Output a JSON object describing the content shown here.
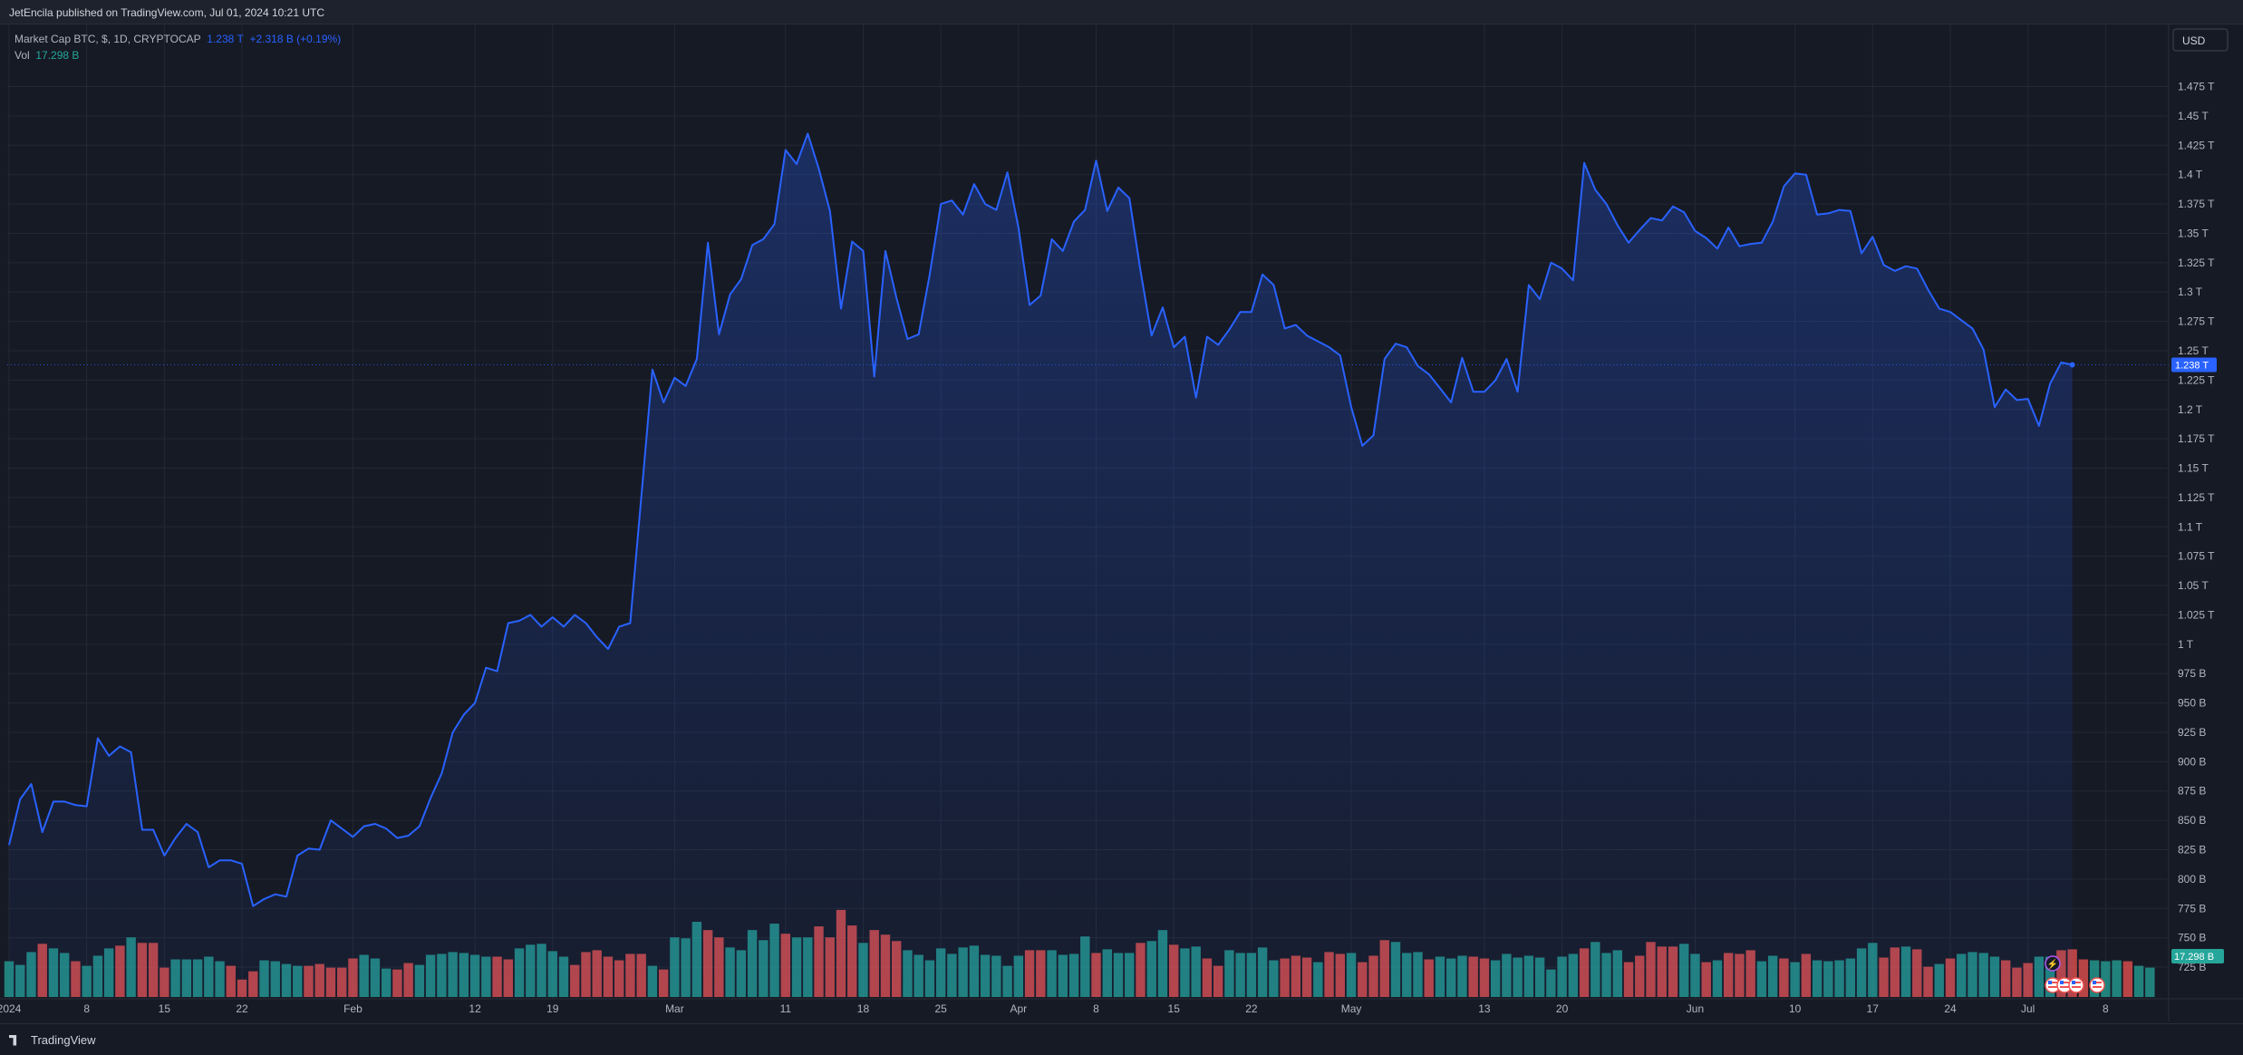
{
  "header": {
    "published_text": "JetEncila published on TradingView.com, Jul 01, 2024 10:21 UTC"
  },
  "legend": {
    "series_label": "Market Cap BTC, $, 1D, CRYPTOCAP",
    "last_value": "1.238 T",
    "change": "+2.318 B (+0.19%)",
    "volume_label": "Vol",
    "volume_value": "17.298 B"
  },
  "currency_button": "USD",
  "brand": "TradingView",
  "colors": {
    "line": "#2962ff",
    "vol_up": "#26a69a",
    "vol_down": "#ef5350",
    "background": "#161a25",
    "grid": "#232834",
    "price_label_bg": "#2962ff",
    "vol_label_bg": "#26a69a"
  },
  "icons": [
    "lightning-icon",
    "us-flag-icon",
    "us-flag-icon",
    "us-flag-icon",
    "us-flag-icon"
  ],
  "chart_data": {
    "type": "line",
    "title": "",
    "xlabel": "",
    "ylabel": "",
    "y_scale": "linear",
    "ylim": [
      715,
      1487
    ],
    "y_unit": "B",
    "y_ticks": [
      "1.475 T",
      "1.45 T",
      "1.425 T",
      "1.4 T",
      "1.375 T",
      "1.35 T",
      "1.325 T",
      "1.3 T",
      "1.275 T",
      "1.25 T",
      "1.225 T",
      "1.2 T",
      "1.175 T",
      "1.15 T",
      "1.125 T",
      "1.1 T",
      "1.075 T",
      "1.05 T",
      "1.025 T",
      "1 T",
      "975 B",
      "950 B",
      "925 B",
      "900 B",
      "875 B",
      "850 B",
      "825 B",
      "800 B",
      "775 B",
      "750 B",
      "725 B"
    ],
    "y_tick_values": [
      1475,
      1450,
      1425,
      1400,
      1375,
      1350,
      1325,
      1300,
      1275,
      1250,
      1225,
      1200,
      1175,
      1150,
      1125,
      1100,
      1075,
      1050,
      1025,
      1000,
      975,
      950,
      925,
      900,
      875,
      850,
      825,
      800,
      775,
      750,
      725
    ],
    "x_ticks": [
      {
        "label": "2024",
        "date": "2024-01-01"
      },
      {
        "label": "8",
        "date": "2024-01-08"
      },
      {
        "label": "15",
        "date": "2024-01-15"
      },
      {
        "label": "22",
        "date": "2024-01-22"
      },
      {
        "label": "Feb",
        "date": "2024-02-01"
      },
      {
        "label": "12",
        "date": "2024-02-12"
      },
      {
        "label": "19",
        "date": "2024-02-19"
      },
      {
        "label": "Mar",
        "date": "2024-03-01"
      },
      {
        "label": "11",
        "date": "2024-03-11"
      },
      {
        "label": "18",
        "date": "2024-03-18"
      },
      {
        "label": "25",
        "date": "2024-03-25"
      },
      {
        "label": "Apr",
        "date": "2024-04-01"
      },
      {
        "label": "8",
        "date": "2024-04-08"
      },
      {
        "label": "15",
        "date": "2024-04-15"
      },
      {
        "label": "22",
        "date": "2024-04-22"
      },
      {
        "label": "May",
        "date": "2024-05-01"
      },
      {
        "label": "13",
        "date": "2024-05-13"
      },
      {
        "label": "20",
        "date": "2024-05-20"
      },
      {
        "label": "Jun",
        "date": "2024-06-01"
      },
      {
        "label": "10",
        "date": "2024-06-10"
      },
      {
        "label": "17",
        "date": "2024-06-17"
      },
      {
        "label": "24",
        "date": "2024-06-24"
      },
      {
        "label": "Jul",
        "date": "2024-07-01"
      },
      {
        "label": "8",
        "date": "2024-07-08"
      }
    ],
    "x_range": [
      "2024-01-01",
      "2024-07-12"
    ],
    "start_date": "2024-01-01",
    "series": [
      {
        "name": "Market Cap BTC",
        "values": [
          829,
          868,
          881,
          840,
          866,
          866,
          863,
          862,
          920,
          905,
          913,
          908,
          842,
          842,
          820,
          835,
          847,
          840,
          810,
          816,
          816,
          813,
          777,
          783,
          787,
          785,
          820,
          826,
          825,
          850,
          843,
          836,
          845,
          847,
          843,
          835,
          837,
          845,
          869,
          890,
          925,
          940,
          950,
          980,
          977,
          1018,
          1020,
          1025,
          1015,
          1023,
          1015,
          1025,
          1018,
          1006,
          996,
          1015,
          1018,
          1126,
          1234,
          1206,
          1227,
          1220,
          1243,
          1342,
          1264,
          1298,
          1311,
          1340,
          1345,
          1358,
          1421,
          1409,
          1435,
          1405,
          1369,
          1286,
          1343,
          1335,
          1228,
          1335,
          1295,
          1260,
          1264,
          1315,
          1375,
          1378,
          1366,
          1392,
          1375,
          1370,
          1402,
          1355,
          1289,
          1297,
          1345,
          1335,
          1360,
          1370,
          1412,
          1369,
          1389,
          1380,
          1318,
          1263,
          1287,
          1253,
          1262,
          1210,
          1262,
          1255,
          1268,
          1283,
          1283,
          1315,
          1306,
          1269,
          1272,
          1263,
          1258,
          1253,
          1246,
          1202,
          1169,
          1178,
          1243,
          1256,
          1253,
          1237,
          1230,
          1218,
          1206,
          1244,
          1215,
          1215,
          1225,
          1243,
          1215,
          1306,
          1294,
          1325,
          1320,
          1310,
          1410,
          1387,
          1375,
          1357,
          1342,
          1353,
          1363,
          1361,
          1373,
          1368,
          1352,
          1346,
          1337,
          1355,
          1339,
          1341,
          1342,
          1360,
          1390,
          1401,
          1400,
          1366,
          1367,
          1370,
          1369,
          1333,
          1347,
          1323,
          1318,
          1322,
          1320,
          1302,
          1286,
          1283,
          1276,
          1269,
          1251,
          1202,
          1217,
          1208,
          1209,
          1186,
          1222,
          1240,
          1238
        ]
      },
      {
        "name": "Vol",
        "values": [
          39,
          35,
          49,
          58,
          53,
          48,
          39,
          34,
          45,
          53,
          56,
          65,
          59,
          59,
          32,
          41,
          41,
          41,
          44,
          39,
          34,
          19,
          28,
          40,
          39,
          36,
          34,
          34,
          36,
          32,
          32,
          42,
          46,
          42,
          31,
          30,
          37,
          35,
          46,
          47,
          49,
          48,
          46,
          44,
          44,
          41,
          53,
          57,
          58,
          50,
          44,
          35,
          49,
          51,
          44,
          40,
          47,
          47,
          34,
          30,
          65,
          64,
          82,
          73,
          65,
          54,
          51,
          73,
          62,
          80,
          69,
          65,
          65,
          77,
          65,
          95,
          78,
          59,
          73,
          68,
          61,
          51,
          46,
          40,
          53,
          47,
          54,
          56,
          46,
          45,
          34,
          45,
          51,
          51,
          51,
          46,
          47,
          66,
          48,
          52,
          48,
          48,
          59,
          61,
          73,
          57,
          53,
          55,
          42,
          34,
          51,
          48,
          48,
          54,
          40,
          42,
          45,
          43,
          38,
          49,
          47,
          48,
          38,
          45,
          62,
          60,
          48,
          49,
          41,
          44,
          42,
          45,
          44,
          42,
          40,
          47,
          43,
          45,
          43,
          30,
          44,
          47,
          53,
          60,
          48,
          51,
          38,
          45,
          60,
          55,
          55,
          58,
          47,
          38,
          40,
          48,
          47,
          51,
          39,
          45,
          42,
          38,
          47,
          40,
          39,
          40,
          42,
          53,
          59,
          43,
          54,
          55,
          52,
          33,
          36,
          42,
          47,
          49,
          48,
          44,
          40,
          32,
          37,
          44,
          44,
          51,
          52,
          41,
          40,
          39,
          40,
          39,
          34,
          32
        ]
      }
    ],
    "volume_scale_top": 255,
    "volume_direction": [
      "u",
      "u",
      "u",
      "d",
      "u",
      "u",
      "d",
      "u",
      "u",
      "u",
      "d",
      "u",
      "d",
      "d",
      "d",
      "u",
      "u",
      "u",
      "u",
      "u",
      "d",
      "d",
      "d",
      "u",
      "u",
      "u",
      "u",
      "d",
      "d",
      "d",
      "d",
      "d",
      "u",
      "u",
      "u",
      "d",
      "d",
      "u",
      "u",
      "u",
      "u",
      "u",
      "u",
      "u",
      "d",
      "d",
      "u",
      "u",
      "u",
      "u",
      "u",
      "d",
      "d",
      "d",
      "d",
      "d",
      "d",
      "d",
      "u",
      "d",
      "u",
      "u",
      "u",
      "d",
      "d",
      "u",
      "u",
      "u",
      "u",
      "u",
      "d",
      "u",
      "u",
      "d",
      "d",
      "d",
      "d",
      "u",
      "d",
      "d",
      "d",
      "u",
      "u",
      "u",
      "u",
      "u",
      "u",
      "u",
      "u",
      "u",
      "u",
      "u",
      "d",
      "d",
      "u",
      "u",
      "u",
      "u",
      "d",
      "u",
      "u",
      "u",
      "d",
      "u",
      "u",
      "d",
      "u",
      "u",
      "d",
      "d",
      "u",
      "u",
      "u",
      "u",
      "u",
      "d",
      "d",
      "d",
      "u",
      "d",
      "d",
      "u",
      "d",
      "d",
      "d",
      "u",
      "u",
      "u",
      "d",
      "u",
      "u",
      "u",
      "d",
      "d",
      "u",
      "u",
      "u",
      "u",
      "u",
      "u",
      "u",
      "u",
      "d",
      "u",
      "u",
      "u",
      "d",
      "d",
      "d",
      "d",
      "d",
      "u",
      "u",
      "d",
      "u",
      "d",
      "d",
      "d",
      "u",
      "u",
      "d",
      "u",
      "d",
      "u",
      "u",
      "u",
      "u",
      "u",
      "u",
      "d",
      "d",
      "u",
      "d",
      "d",
      "u",
      "d",
      "u",
      "u",
      "u",
      "u",
      "d",
      "d",
      "d",
      "u",
      "u",
      "d",
      "d",
      "d",
      "u",
      "u",
      "u",
      "d",
      "u",
      "u"
    ],
    "last_price_label": "1.238 T",
    "last_volume_label": "17.298 B"
  }
}
